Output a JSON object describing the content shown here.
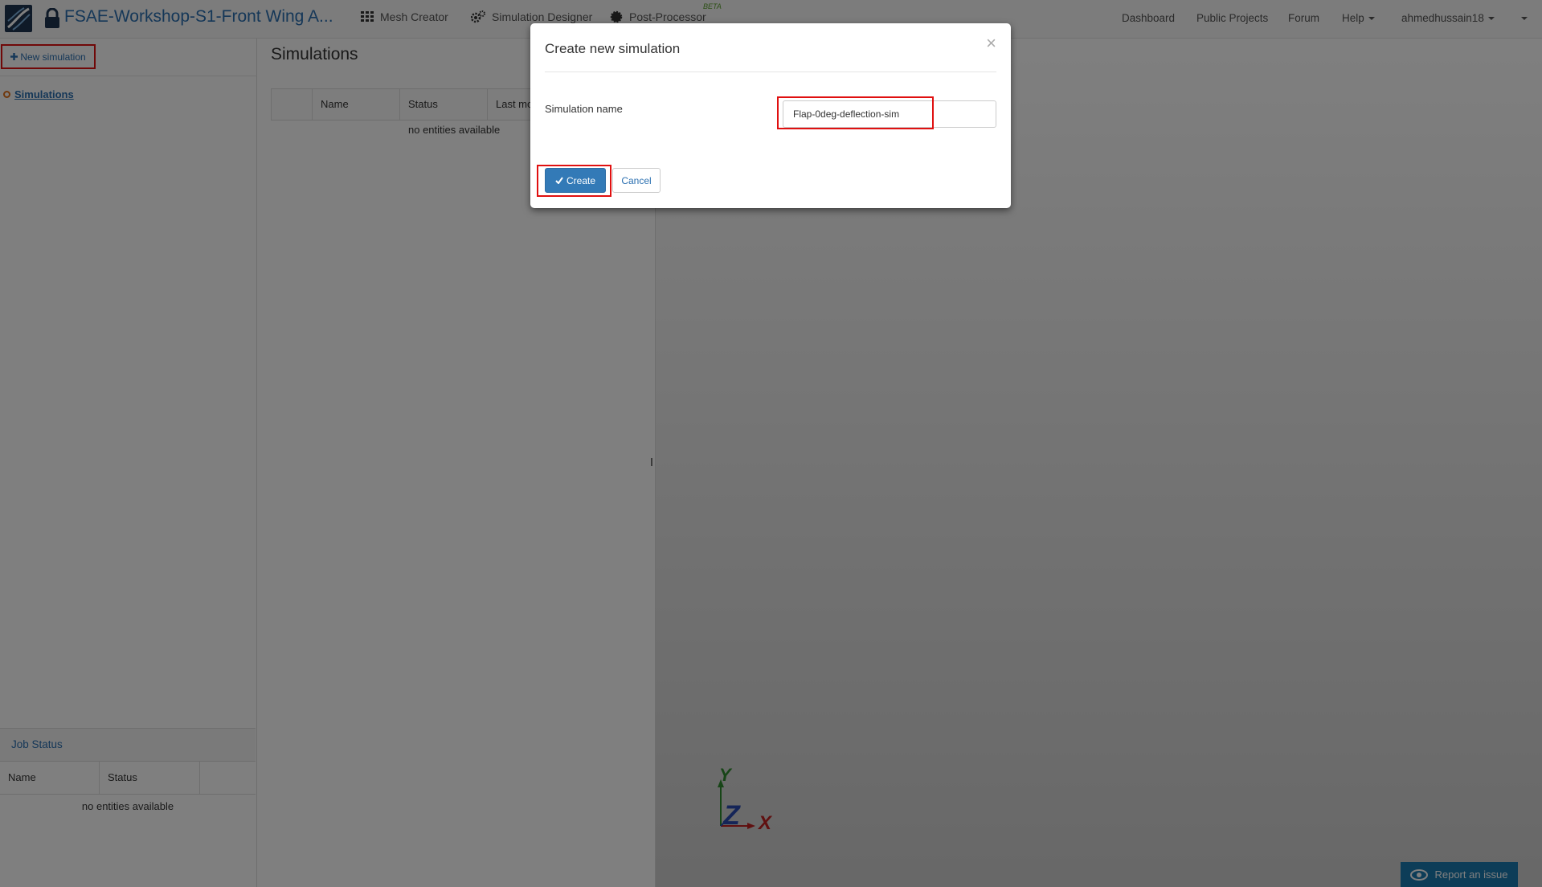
{
  "navbar": {
    "project_title": "FSAE-Workshop-S1-Front Wing A...",
    "mesh_creator": "Mesh Creator",
    "simulation_designer": "Simulation Designer",
    "post_processor": "Post-Processor",
    "beta_badge": "BETA",
    "dashboard": "Dashboard",
    "public_projects": "Public Projects",
    "forum": "Forum",
    "help": "Help",
    "user": "ahmedhussain18"
  },
  "sidebar": {
    "new_simulation": "New simulation",
    "tree_item": "Simulations",
    "job_status": {
      "title": "Job Status",
      "columns": [
        "Name",
        "Status"
      ],
      "empty": "no entities available"
    }
  },
  "main": {
    "title": "Simulations",
    "columns": [
      "Name",
      "Status",
      "Last mo"
    ],
    "empty": "no entities available"
  },
  "viewer": {
    "axis_y": "Y",
    "axis_z": "Z",
    "axis_x": "X"
  },
  "report_issue": "Report an issue",
  "modal": {
    "title": "Create new simulation",
    "close_glyph": "×",
    "field_label": "Simulation name",
    "field_value": "Flap-0deg-deflection-sim",
    "create_label": "Create",
    "cancel_label": "Cancel"
  },
  "colors": {
    "brand_blue": "#2a6fb0",
    "primary_button": "#337ab7",
    "highlight_red": "#e01010"
  }
}
